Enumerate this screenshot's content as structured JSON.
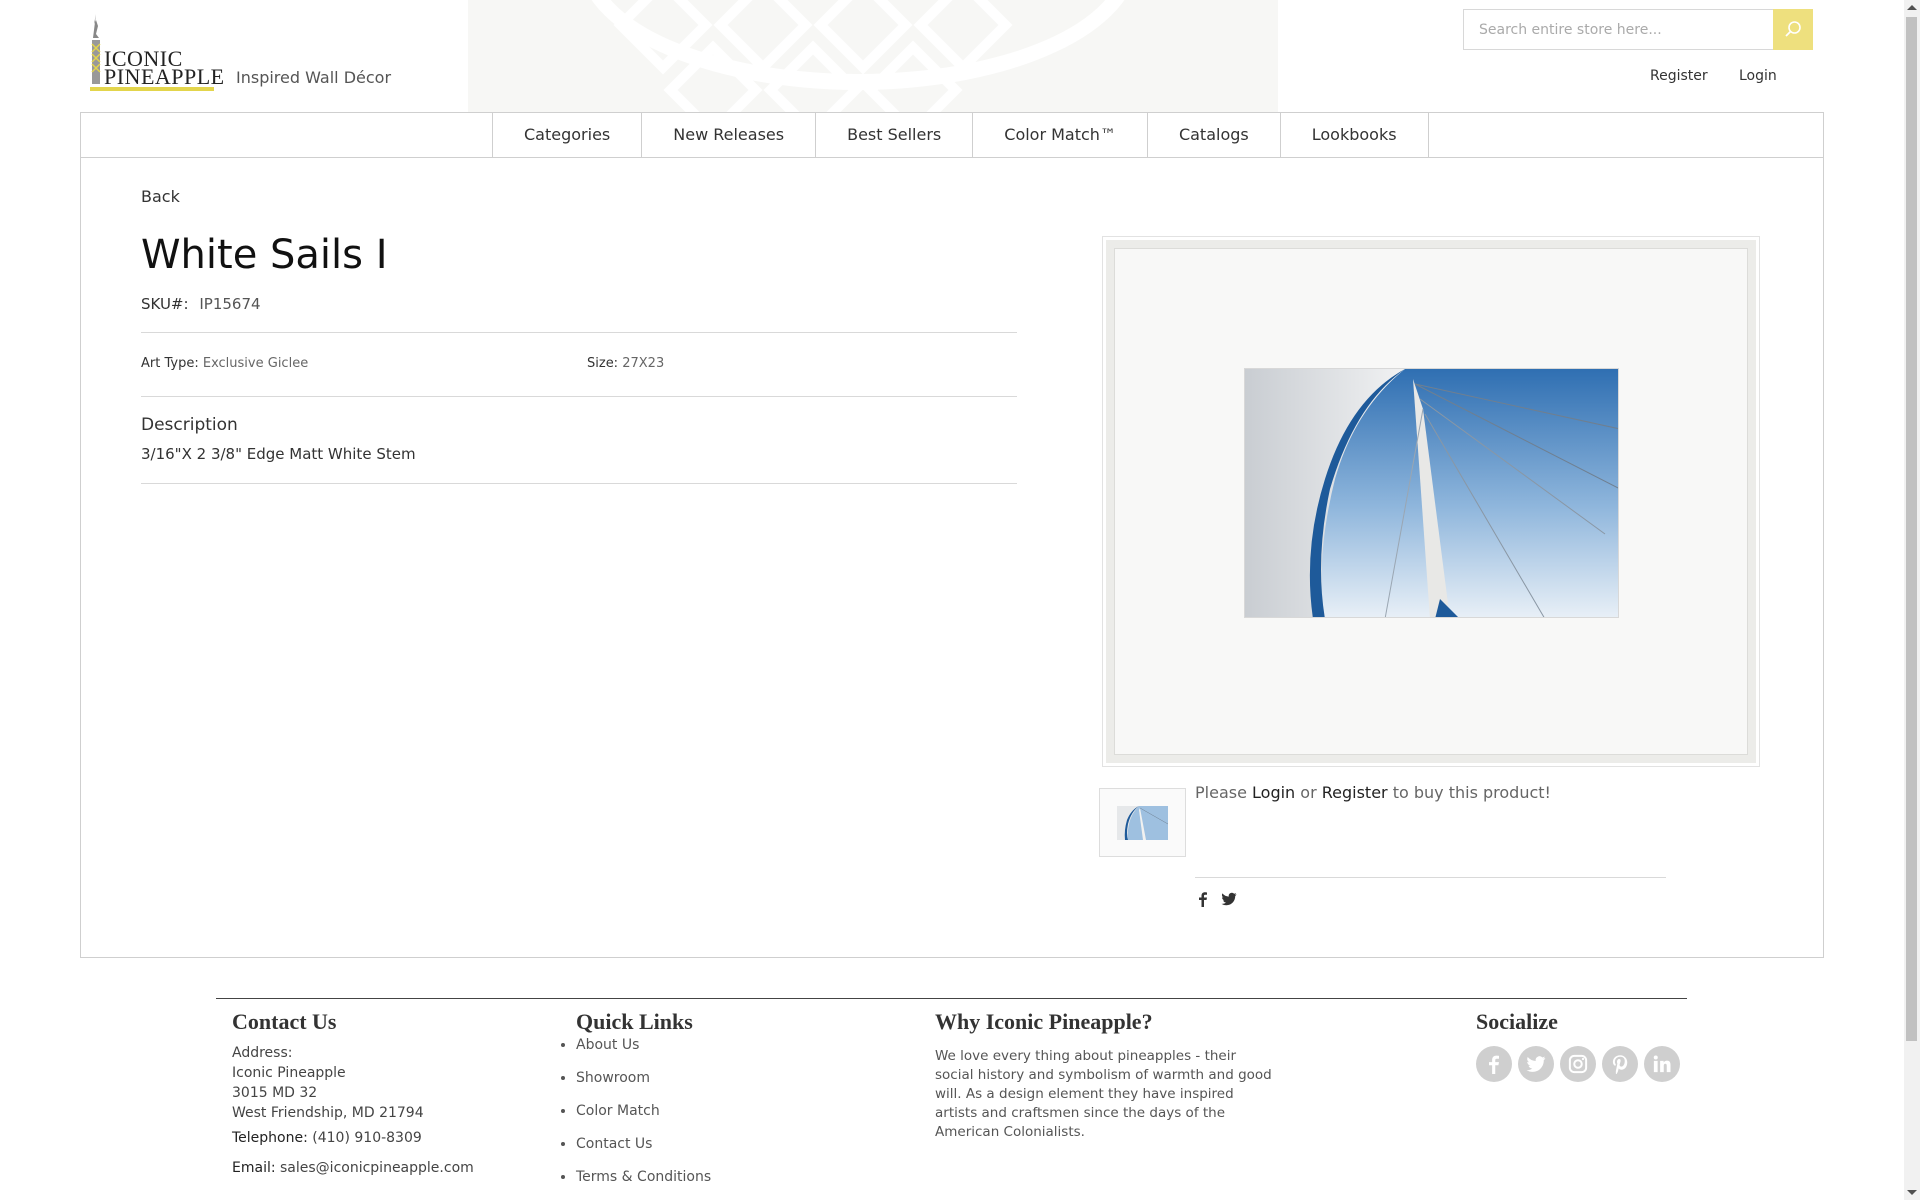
{
  "header": {
    "logo_line1": "ICONIC",
    "logo_line2": "PINEAPPLE",
    "tagline": "Inspired Wall Décor",
    "search_placeholder": "Search entire store here...",
    "search_icon": "search-icon",
    "register_label": "Register",
    "login_label": "Login"
  },
  "nav": {
    "items": [
      "Categories",
      "New Releases",
      "Best Sellers",
      "Color Match™",
      "Catalogs",
      "Lookbooks"
    ]
  },
  "product": {
    "back_label": "Back",
    "title": "White Sails I",
    "sku_label": "SKU#:",
    "sku_value": "IP15674",
    "art_type_label": "Art Type:",
    "art_type_value": "Exclusive Giclee",
    "size_label": "Size:",
    "size_value": "27X23",
    "description_heading": "Description",
    "description_text": "3/16\"X 2 3/8\" Edge Matt White Stem",
    "buy_prefix": "Please",
    "buy_login": "Login",
    "buy_or": "or",
    "buy_register": "Register",
    "buy_suffix": "to buy this product!",
    "share_icons": [
      "facebook-icon",
      "twitter-icon"
    ]
  },
  "footer": {
    "contact": {
      "heading": "Contact Us",
      "address_label": "Address:",
      "address_lines": [
        "Iconic Pineapple",
        "3015 MD 32",
        "West Friendship, MD 21794"
      ],
      "telephone_label": "Telephone:",
      "telephone_value": "(410) 910-8309",
      "email_label": "Email:",
      "email_value": "sales@iconicpineapple.com"
    },
    "quick_links": {
      "heading": "Quick Links",
      "items": [
        "About Us",
        "Showroom",
        "Color Match",
        "Contact Us",
        "Terms & Conditions"
      ]
    },
    "why": {
      "heading": "Why Iconic Pineapple?",
      "text": "We love every thing about pineapples - their social history and symbolism of warmth and good will. As a design element they have inspired artists and craftsmen since the days of the American Colonialists."
    },
    "socialize": {
      "heading": "Socialize",
      "icons": [
        "facebook-icon",
        "twitter-icon",
        "instagram-icon",
        "pinterest-icon",
        "linkedin-icon"
      ]
    }
  },
  "colors": {
    "accent": "#eee07e",
    "logo_bar": "#e3d54c",
    "border": "#cfcfcf",
    "social_circle": "#cfcfcf"
  }
}
